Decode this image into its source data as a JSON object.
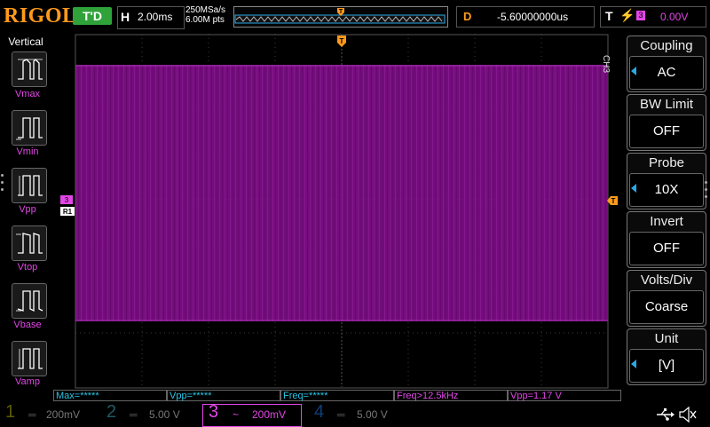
{
  "brand": {
    "logo": "RIGOL"
  },
  "status": {
    "run_state": "T'D"
  },
  "timebase": {
    "label": "H",
    "value": "2.00ms",
    "sample_rate": "250MSa/s",
    "memory_depth": "6.00M pts"
  },
  "trigger_position": {
    "marker": "T"
  },
  "delay": {
    "label": "D",
    "value": "-5.60000000us"
  },
  "trigger": {
    "label": "T",
    "edge_symbol": "⚡",
    "source": "3",
    "level": "0.00V"
  },
  "left_menu": {
    "title": "Vertical",
    "items": [
      {
        "label": "Vmax"
      },
      {
        "label": "Vmin"
      },
      {
        "label": "Vpp"
      },
      {
        "label": "Vtop"
      },
      {
        "label": "Vbase"
      },
      {
        "label": "Vamp"
      }
    ]
  },
  "right_menu": {
    "channel_tag": "CH3",
    "items": [
      {
        "title": "Coupling",
        "value": "AC",
        "has_arrow": true
      },
      {
        "title": "BW Limit",
        "value": "OFF",
        "has_arrow": false
      },
      {
        "title": "Probe",
        "value": "10X",
        "has_arrow": true
      },
      {
        "title": "Invert",
        "value": "OFF",
        "has_arrow": false
      },
      {
        "title": "Volts/Div",
        "value": "Coarse",
        "has_arrow": false
      },
      {
        "title": "Unit",
        "value": "[V]",
        "has_arrow": true
      }
    ]
  },
  "markers": {
    "channel_marker": "3",
    "ref_marker": "R1",
    "trigger_level_marker": "T"
  },
  "measurements": [
    {
      "text": "Max=*****",
      "color": "#29c6e6"
    },
    {
      "text": "Vpp=*****",
      "color": "#29c6e6"
    },
    {
      "text": "Freq=*****",
      "color": "#29c6e6"
    },
    {
      "text": "Freq>12.5kHz",
      "color": "#e246e6"
    },
    {
      "text": "Vpp=1.17 V",
      "color": "#e246e6"
    }
  ],
  "channels": [
    {
      "num": "1",
      "coupling_icon": "dc-coupling-icon",
      "scale": "200mV",
      "active": false
    },
    {
      "num": "2",
      "coupling_icon": "dc-coupling-icon",
      "scale": "5.00 V",
      "active": false
    },
    {
      "num": "3",
      "coupling_icon": "ac-coupling-icon",
      "scale": "200mV",
      "active": true
    },
    {
      "num": "4",
      "coupling_icon": "dc-coupling-icon",
      "scale": "5.00 V",
      "active": false
    }
  ],
  "colors": {
    "ch3": "#e246e6",
    "waveform": "#7a0e82",
    "accent": "#ff9a1a",
    "grid": "#555555",
    "run": "#2fa33a"
  }
}
